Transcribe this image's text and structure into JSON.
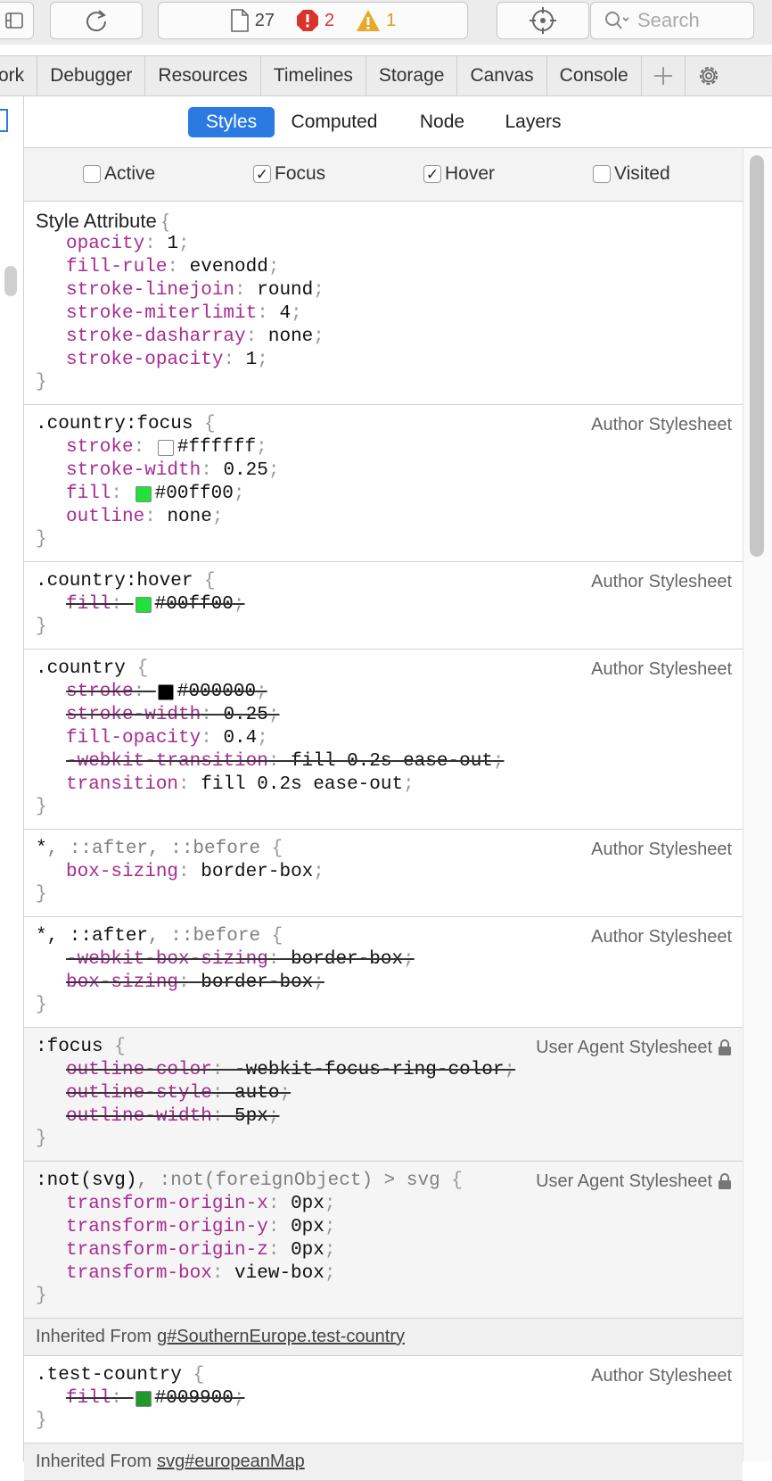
{
  "toolbar": {
    "file_count": "27",
    "error_count": "2",
    "warning_count": "1",
    "search_placeholder": "Search"
  },
  "tabs": [
    "ork",
    "Debugger",
    "Resources",
    "Timelines",
    "Storage",
    "Canvas",
    "Console"
  ],
  "subtabs": [
    "Styles",
    "Computed",
    "Node",
    "Layers"
  ],
  "pseudo_classes": [
    {
      "label": "Active",
      "checked": false
    },
    {
      "label": "Focus",
      "checked": true
    },
    {
      "label": "Hover",
      "checked": true
    },
    {
      "label": "Visited",
      "checked": false
    }
  ],
  "style_attribute": {
    "selector": "Style Attribute",
    "props": [
      {
        "name": "opacity",
        "value": "1"
      },
      {
        "name": "fill-rule",
        "value": "evenodd"
      },
      {
        "name": "stroke-linejoin",
        "value": "round"
      },
      {
        "name": "stroke-miterlimit",
        "value": "4"
      },
      {
        "name": "stroke-dasharray",
        "value": "none"
      },
      {
        "name": "stroke-opacity",
        "value": "1"
      }
    ]
  },
  "rule_focus": {
    "selector": ".country:focus",
    "origin": "Author Stylesheet",
    "props": [
      {
        "name": "stroke",
        "value": "#ffffff",
        "swatch": "#ffffff"
      },
      {
        "name": "stroke-width",
        "value": "0.25"
      },
      {
        "name": "fill",
        "value": "#00ff00",
        "swatch": "#22e03a"
      },
      {
        "name": "outline",
        "value": "none"
      }
    ]
  },
  "rule_hover": {
    "selector": ".country:hover",
    "origin": "Author Stylesheet",
    "props": [
      {
        "name": "fill",
        "value": "#00ff00",
        "swatch": "#22e03a",
        "struck": true
      }
    ]
  },
  "rule_country": {
    "selector": ".country",
    "origin": "Author Stylesheet",
    "props": [
      {
        "name": "stroke",
        "value": "#000000",
        "swatch": "#000000",
        "struck": true
      },
      {
        "name": "stroke-width",
        "value": "0.25",
        "struck": true
      },
      {
        "name": "fill-opacity",
        "value": "0.4"
      },
      {
        "name": "-webkit-transition",
        "value": "fill 0.2s ease-out",
        "struck": true
      },
      {
        "name": "transition",
        "value": "fill 0.2s ease-out"
      }
    ]
  },
  "rule_star1": {
    "selector_main": "*",
    "selector_rest": ", ::after, ::before",
    "origin": "Author Stylesheet",
    "props": [
      {
        "name": "box-sizing",
        "value": "border-box"
      }
    ]
  },
  "rule_star2": {
    "selector_main": "*, ::after",
    "selector_rest": ", ::before",
    "origin": "Author Stylesheet",
    "props": [
      {
        "name": "-webkit-box-sizing",
        "value": "border-box",
        "struck": true
      },
      {
        "name": "box-sizing",
        "value": "border-box",
        "struck": true
      }
    ]
  },
  "rule_ua_focus": {
    "selector": ":focus",
    "origin": "User Agent Stylesheet",
    "props": [
      {
        "name": "outline-color",
        "value": "-webkit-focus-ring-color",
        "struck": true
      },
      {
        "name": "outline-style",
        "value": "auto",
        "struck": true
      },
      {
        "name": "outline-width",
        "value": "5px",
        "struck": true
      }
    ]
  },
  "rule_ua_not": {
    "selector_main": ":not(svg)",
    "selector_rest": ", :not(foreignObject) > svg",
    "origin": "User Agent Stylesheet",
    "props": [
      {
        "name": "transform-origin-x",
        "value": "0px"
      },
      {
        "name": "transform-origin-y",
        "value": "0px"
      },
      {
        "name": "transform-origin-z",
        "value": "0px"
      },
      {
        "name": "transform-box",
        "value": "view-box"
      }
    ]
  },
  "inherited_1": {
    "prefix": "Inherited From",
    "link": "g#SouthernEurope.test-country"
  },
  "rule_test_country": {
    "selector": ".test-country",
    "origin": "Author Stylesheet",
    "props": [
      {
        "name": "fill",
        "value": "#009900",
        "swatch": "#1f9a2a",
        "struck": true
      }
    ]
  },
  "inherited_2": {
    "prefix": "Inherited From",
    "link": "svg#europeanMap"
  },
  "colors": {
    "accent": "#2a7ae2",
    "property": "#a62c91",
    "error": "#d8342b",
    "warning": "#d9a020"
  }
}
